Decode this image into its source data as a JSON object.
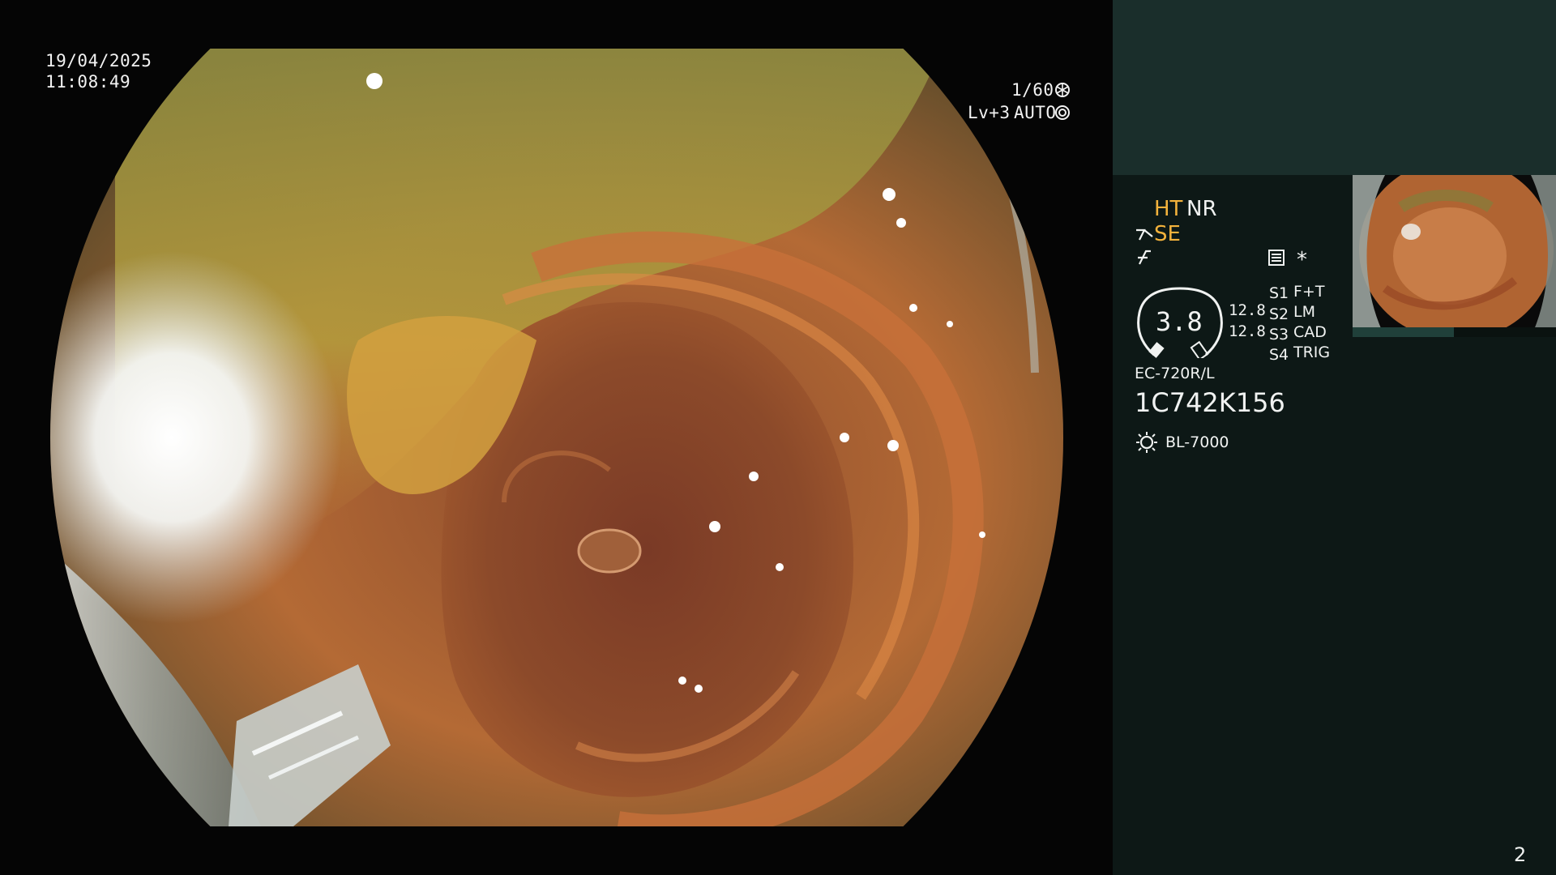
{
  "overlay": {
    "date": "19/04/2025",
    "time": "11:08:49",
    "shutter": "1/60",
    "shutter_icon": "aperture-icon",
    "level": "Lv+3",
    "mode": "AUTO",
    "mode_icon": "target-icon"
  },
  "panel": {
    "ht": "HT",
    "nr": "NR",
    "se": "SE",
    "se_icon": "fork-icon",
    "f_icon": "italic-f-icon",
    "menu_icon": "settings-list-icon",
    "star": "*",
    "gauge_value": "3.8",
    "values": [
      "12.8",
      "12.8"
    ],
    "switches": [
      {
        "key": "S1",
        "value": "F+T"
      },
      {
        "key": "S2",
        "value": "LM"
      },
      {
        "key": "S3",
        "value": "CAD"
      },
      {
        "key": "S4",
        "value": "TRIG"
      }
    ],
    "scope_model": "EC-720R/L",
    "serial": "1C742K156",
    "light_source": "BL-7000",
    "light_icon": "sun-icon",
    "page_number": "2"
  },
  "colors": {
    "panel_bg": "#0d1816",
    "panel_top": "#1a2e2b",
    "accent": "#f3b23c"
  }
}
